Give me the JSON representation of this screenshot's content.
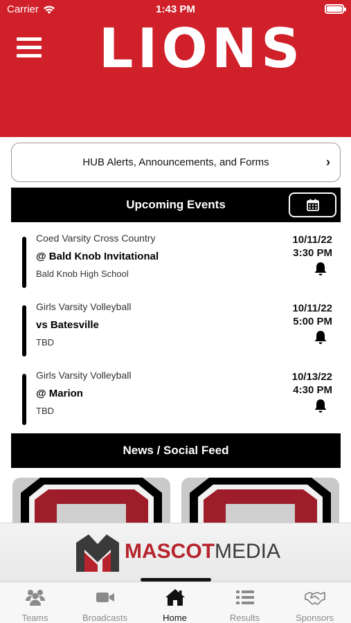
{
  "status_bar": {
    "carrier": "Carrier",
    "time": "1:43 PM"
  },
  "header": {
    "logo_text": "LIONS",
    "menu_icon": "hamburger-menu-icon",
    "background_color": "#d0202a"
  },
  "hub_button": {
    "label": "HUB Alerts, Announcements, and Forms"
  },
  "upcoming": {
    "title": "Upcoming Events",
    "calendar_icon": "calendar-icon",
    "events": [
      {
        "sport": "Coed Varsity Cross Country",
        "opponent": "@ Bald Knob Invitational",
        "location": "Bald Knob High School",
        "date": "10/11/22",
        "time": "3:30 PM"
      },
      {
        "sport": "Girls Varsity Volleyball",
        "opponent": "vs Batesville",
        "location": "TBD",
        "date": "10/11/22",
        "time": "5:00 PM"
      },
      {
        "sport": "Girls Varsity Volleyball",
        "opponent": "@ Marion",
        "location": "TBD",
        "date": "10/13/22",
        "time": "4:30 PM"
      }
    ]
  },
  "news": {
    "title": "News / Social Feed"
  },
  "sponsor": {
    "name_part1": "MASCOT",
    "name_part2": "MEDIA",
    "brand_color": "#b6232c"
  },
  "tabbar": {
    "tabs": [
      {
        "label": "Teams",
        "icon": "teams-icon"
      },
      {
        "label": "Broadcasts",
        "icon": "video-camera-icon"
      },
      {
        "label": "Home",
        "icon": "home-icon"
      },
      {
        "label": "Results",
        "icon": "list-icon"
      },
      {
        "label": "Sponsors",
        "icon": "handshake-icon"
      }
    ],
    "active": "Home"
  }
}
